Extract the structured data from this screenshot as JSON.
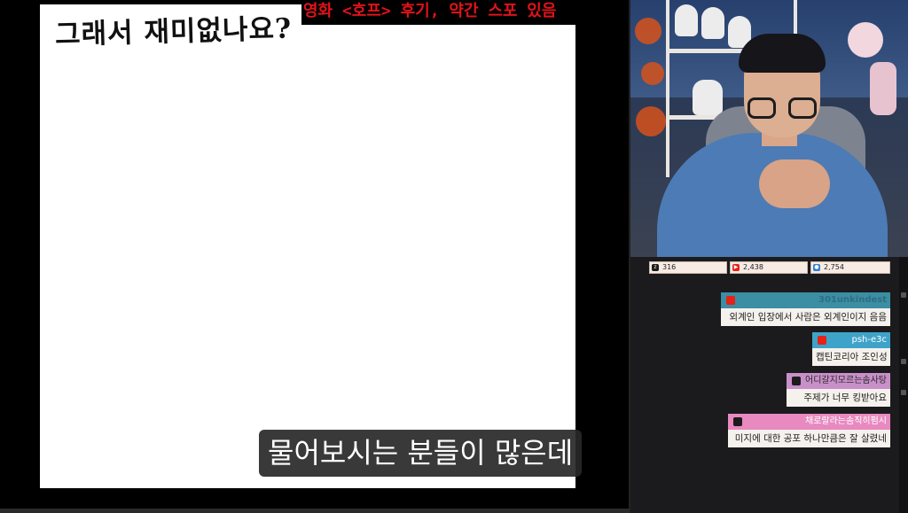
{
  "whiteboard": {
    "title": "그래서 재미없나요?",
    "banner": "영화 <호프> 후기, 약간 스포 있음",
    "subtitle": "물어보시는 분들이 많은데"
  },
  "stats": [
    {
      "icon": "chzzk-icon",
      "value": "316",
      "color": "#1c1c1c"
    },
    {
      "icon": "youtube-icon",
      "value": "2,438",
      "color": "#e62117"
    },
    {
      "icon": "viewer-icon",
      "value": "2,754",
      "color": "#2f80d1"
    }
  ],
  "chat": [
    {
      "user": "301unkindest",
      "platform": "youtube-icon",
      "head_color": "#3b8ea3",
      "user_color": "#2e6f80",
      "message": "외계인 입장에서 사람은 외계인이지 음음"
    },
    {
      "user": "psh-e3c",
      "platform": "youtube-icon",
      "head_color": "#3fa3c9",
      "user_color": "#ffffff",
      "message": "캡틴코리아 조인성"
    },
    {
      "user": "어디갈지모르는솜사탕",
      "platform": "chzzk-icon",
      "head_color": "#c98fc9",
      "user_color": "#2a2a2a",
      "message": "주제가 너무 킹받아요"
    },
    {
      "user": "채로랄라는솜직히펌시",
      "platform": "chzzk-icon",
      "head_color": "#e889c0",
      "user_color": "#ffffff",
      "message": "미지에 대한 공포 하나만큼은 잘 살렸네"
    }
  ]
}
